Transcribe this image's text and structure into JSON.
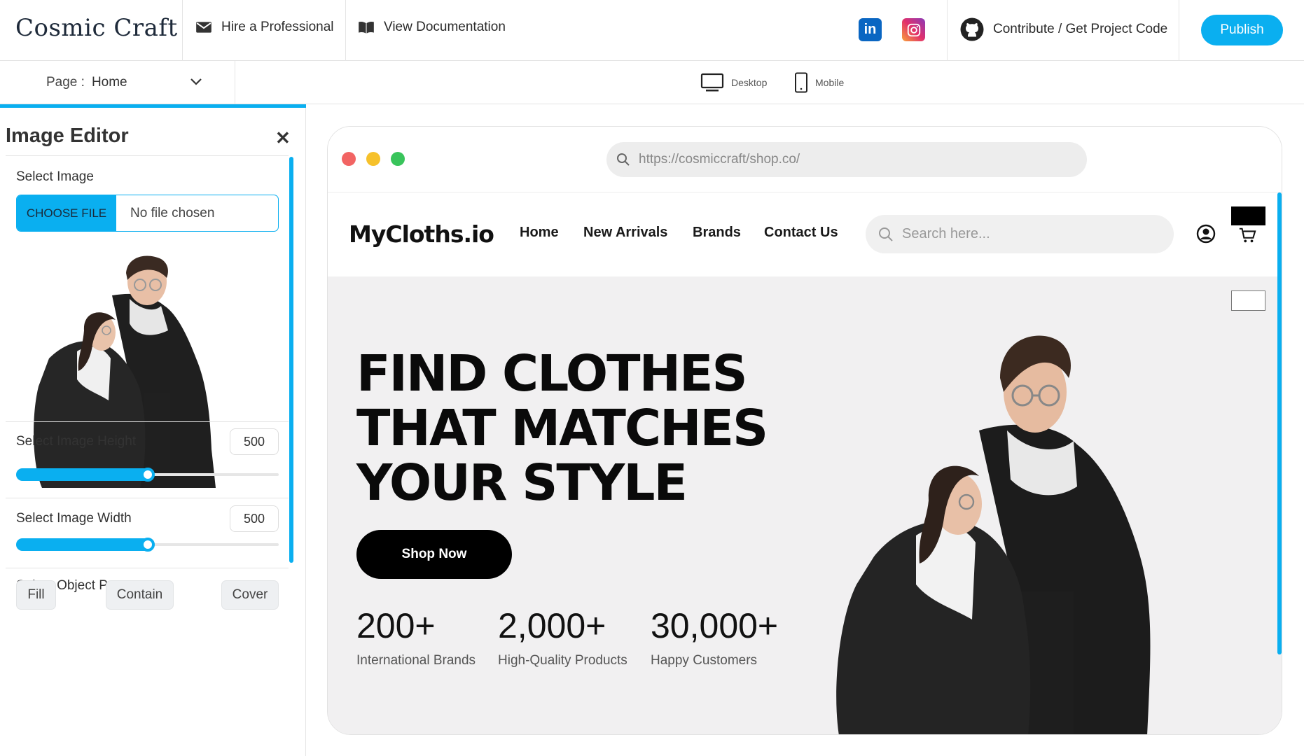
{
  "topbar": {
    "brand": "Cosmic Craft",
    "hire": "Hire a Professional",
    "docs": "View Documentation",
    "linkedin_icon": "linkedin-icon",
    "instagram_icon": "instagram-icon",
    "contribute": "Contribute / Get Project Code",
    "publish": "Publish"
  },
  "subbar": {
    "page_label": "Page :",
    "page_value": "Home",
    "desktop": "Desktop",
    "mobile": "Mobile"
  },
  "editor": {
    "title": "Image Editor",
    "close": "✕",
    "select_image": "Select Image",
    "choose_file": "CHOOSE FILE",
    "no_file": "No file chosen",
    "height_label": "Select Image Height",
    "height_value": "500",
    "height_fraction": 0.5,
    "width_label": "Select Image Width",
    "width_value": "500",
    "width_fraction": 0.5,
    "object_label": "Select Object Property",
    "object_options": [
      "Fill",
      "Contain",
      "Cover"
    ]
  },
  "preview": {
    "url": "https://cosmiccraft/shop.co/",
    "dots": [
      "#f26463",
      "#f6c12b",
      "#39c45b"
    ],
    "site": {
      "logo": "MyCloths.io",
      "nav": [
        "Home",
        "New Arrivals",
        "Brands",
        "Contact Us"
      ],
      "search_placeholder": "Search here...",
      "hero_lines": [
        "FIND CLOTHES",
        "THAT MATCHES",
        "YOUR STYLE"
      ],
      "cta": "Shop Now",
      "stats": [
        {
          "value": "200+",
          "label": "International Brands"
        },
        {
          "value": "2,000+",
          "label": "High-Quality Products"
        },
        {
          "value": "30,000+",
          "label": "Happy Customers"
        }
      ]
    }
  },
  "colors": {
    "accent": "#0aaff0",
    "black": "#000000",
    "hero_bg": "#f1f0f1"
  }
}
